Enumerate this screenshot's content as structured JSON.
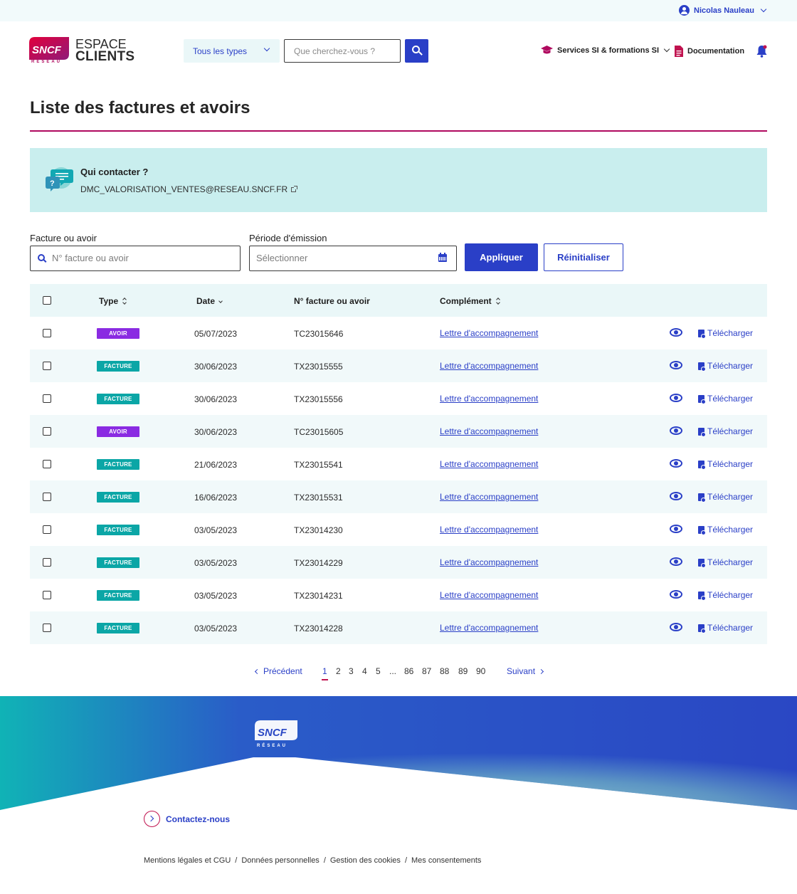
{
  "user": {
    "name": "Nicolas Nauleau"
  },
  "header": {
    "brand_top": "ESPACE",
    "brand_bottom": "CLIENTS",
    "logo_text": "SNCF",
    "logo_sub": "RÉSEAU",
    "type_select": "Tous les types",
    "search_placeholder": "Que cherchez-vous ?",
    "nav_services": "Services SI & formations SI",
    "nav_documentation": "Documentation"
  },
  "page": {
    "title": "Liste des factures et avoirs"
  },
  "contact": {
    "title": "Qui contacter ?",
    "email": "DMC_VALORISATION_VENTES@RESEAU.SNCF.FR"
  },
  "filters": {
    "invoice_label": "Facture ou avoir",
    "invoice_placeholder": "N° facture ou avoir",
    "period_label": "Période d'émission",
    "period_placeholder": "Sélectionner",
    "apply": "Appliquer",
    "reset": "Réinitialiser"
  },
  "table": {
    "headers": {
      "type": "Type",
      "date": "Date",
      "number": "N° facture ou avoir",
      "complement": "Complément"
    },
    "download_label": "Télécharger",
    "rows": [
      {
        "type": "AVOIR",
        "kind": "avoir",
        "date": "05/07/2023",
        "number": "TC23015646",
        "complement": "Lettre d'accompagnement"
      },
      {
        "type": "FACTURE",
        "kind": "facture",
        "date": "30/06/2023",
        "number": "TX23015555",
        "complement": "Lettre d'accompagnement"
      },
      {
        "type": "FACTURE",
        "kind": "facture",
        "date": "30/06/2023",
        "number": "TX23015556",
        "complement": "Lettre d'accompagnement"
      },
      {
        "type": "AVOIR",
        "kind": "avoir",
        "date": "30/06/2023",
        "number": "TC23015605",
        "complement": "Lettre d'accompagnement"
      },
      {
        "type": "FACTURE",
        "kind": "facture",
        "date": "21/06/2023",
        "number": "TX23015541",
        "complement": "Lettre d'accompagnement"
      },
      {
        "type": "FACTURE",
        "kind": "facture",
        "date": "16/06/2023",
        "number": "TX23015531",
        "complement": "Lettre d'accompagnement"
      },
      {
        "type": "FACTURE",
        "kind": "facture",
        "date": "03/05/2023",
        "number": "TX23014230",
        "complement": "Lettre d'accompagnement"
      },
      {
        "type": "FACTURE",
        "kind": "facture",
        "date": "03/05/2023",
        "number": "TX23014229",
        "complement": "Lettre d'accompagnement"
      },
      {
        "type": "FACTURE",
        "kind": "facture",
        "date": "03/05/2023",
        "number": "TX23014231",
        "complement": "Lettre d'accompagnement"
      },
      {
        "type": "FACTURE",
        "kind": "facture",
        "date": "03/05/2023",
        "number": "TX23014228",
        "complement": "Lettre d'accompagnement"
      }
    ]
  },
  "pagination": {
    "prev": "Précédent",
    "next": "Suivant",
    "pages": [
      "1",
      "2",
      "3",
      "4",
      "5",
      "...",
      "86",
      "87",
      "88",
      "89",
      "90"
    ],
    "current": "1"
  },
  "footer": {
    "logo_text": "SNCF",
    "logo_sub": "RÉSEAU",
    "contact": "Contactez-nous",
    "links": [
      "Mentions légales et CGU",
      "Données personnelles",
      "Gestion des cookies",
      "Mes consentements"
    ],
    "separator": "/"
  },
  "colors": {
    "primary": "#2a3fc7",
    "brand": "#b0095f",
    "avoir": "#8a2be2",
    "facture": "#0ba6a6",
    "contact_bg": "#c9eeee"
  }
}
